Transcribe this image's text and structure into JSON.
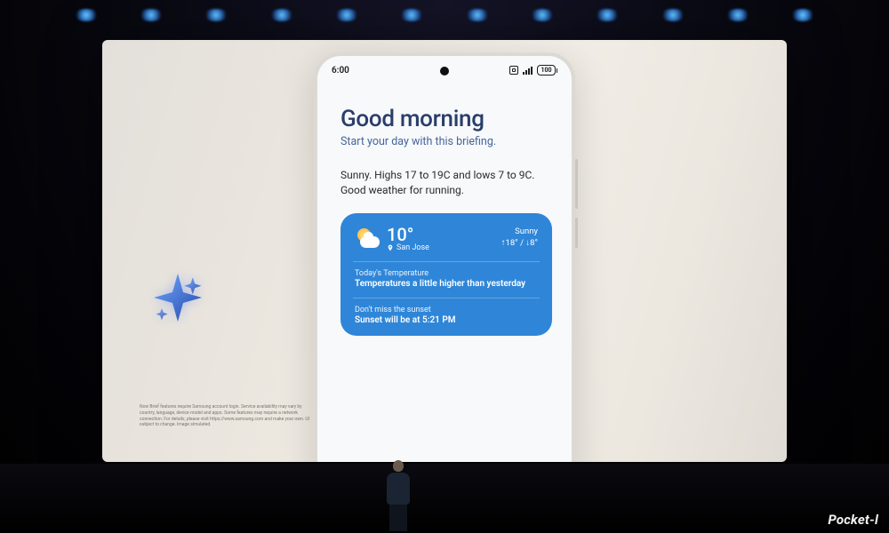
{
  "watermark": "Pocket-l",
  "statusbar": {
    "time": "6:00",
    "battery": "100"
  },
  "briefing": {
    "title": "Good morning",
    "subtitle": "Start your day with this briefing.",
    "summary_line1": "Sunny. Highs 17 to 19C and lows 7 to 9C.",
    "summary_line2": "Good weather for running."
  },
  "weather_card": {
    "temp": "10°",
    "location": "San Jose",
    "condition": "Sunny",
    "hilo": "↑18° / ↓8°",
    "section1_label": "Today's Temperature",
    "section1_body": "Temperatures a little higher than yesterday",
    "section2_label": "Don't miss the sunset",
    "section2_body": "Sunset will be at 5:21 PM"
  },
  "fineprint": "Now Brief features require Samsung account login. Service availability may vary by country, language, device model and apps. Some features may require a network connection. For details, please visit https://www.samsung.com and make your own. UI subject to change. Image simulated."
}
